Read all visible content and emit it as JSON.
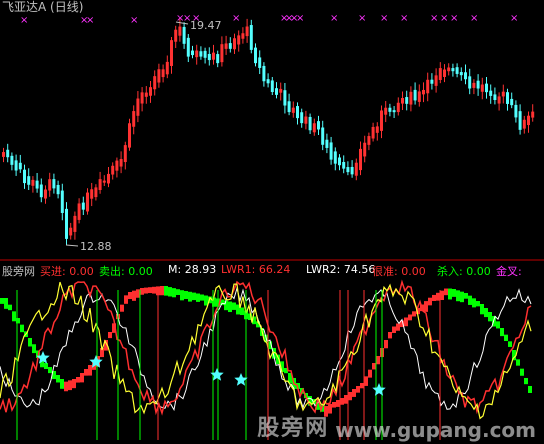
{
  "title": "飞亚达A (日线)",
  "price_high_label": "19.47",
  "price_low_label": "12.88",
  "indicator": {
    "name": "股旁网",
    "fields": [
      {
        "label": "买进:",
        "value": "0.00",
        "color": "#ff3030"
      },
      {
        "label": "卖出:",
        "value": "0.00",
        "color": "#00ff00"
      },
      {
        "label": "M:",
        "value": "28.93",
        "color": "#ffffff"
      },
      {
        "label": "LWR1:",
        "value": "66.24",
        "color": "#ff3030"
      },
      {
        "label": "LWR2:",
        "value": "74.56",
        "color": "#ffffff"
      },
      {
        "label": "很准:",
        "value": "0.00",
        "color": "#ff3030"
      },
      {
        "label": "杀入:",
        "value": "0.00",
        "color": "#00ff00"
      },
      {
        "label": "金叉:",
        "value": "",
        "color": "#ff33ff"
      }
    ]
  },
  "watermark": {
    "brand": "股旁网",
    "url": "www.gupang.com"
  },
  "colors": {
    "up": "#ff3232",
    "down": "#54ffff",
    "marker": "#ff33ff",
    "white_line": "#ffffff",
    "red_line": "#ff3030",
    "yellow_line": "#ffff33",
    "green": "#00ff00",
    "star": "#54ffff",
    "divider": "#c00000"
  }
}
